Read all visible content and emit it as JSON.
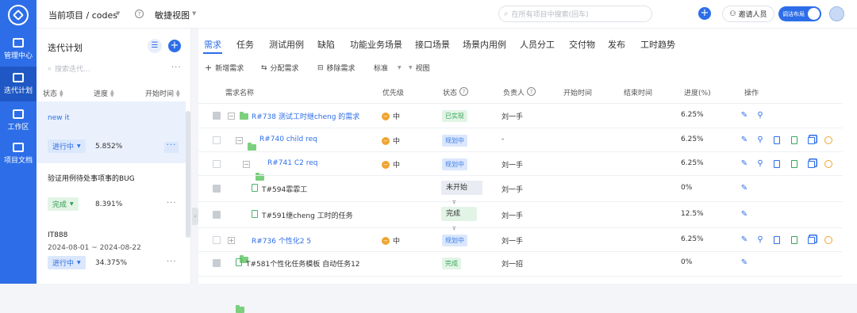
{
  "leftnav": {
    "items": [
      {
        "label": "管理中心",
        "icon": "monitor-icon"
      },
      {
        "label": "迭代计划",
        "icon": "clipboard-icon",
        "active": true
      },
      {
        "label": "工作区",
        "icon": "clipboard-check-icon"
      },
      {
        "label": "项目文档",
        "icon": "book-icon"
      }
    ]
  },
  "topbar": {
    "project_label": "当前项目 / codes",
    "view_label": "敏捷视图",
    "search_placeholder": "在所有项目中搜索(回车)",
    "invite_label": "邀请人员",
    "layout_toggle_label": "调洁布局"
  },
  "sprint_panel": {
    "title": "迭代计划",
    "search_placeholder": "搜索迭代...",
    "more": "···",
    "columns": [
      "状态",
      "进度",
      "开始时间"
    ],
    "sprints": [
      {
        "name": "new it",
        "status": "进行中",
        "progress": "5.852%",
        "dates": "",
        "selected": true
      },
      {
        "name": "验证用例待处事项事的BUG",
        "status": "完成",
        "progress": "8.391%",
        "dates": ""
      },
      {
        "name": "IT888",
        "status": "进行中",
        "progress": "34.375%",
        "dates": "2024-08-01 ~ 2024-08-22"
      }
    ]
  },
  "tabs": [
    "需求",
    "任务",
    "测试用例",
    "缺陷",
    "功能业务场景",
    "接口场景",
    "场景内用例",
    "人员分工",
    "交付物",
    "发布",
    "工时趋势"
  ],
  "toolbar": {
    "add": "新增需求",
    "assign": "分配需求",
    "remove": "移除需求",
    "mode": "标准",
    "view": "视图"
  },
  "table": {
    "headers": {
      "name": "需求名称",
      "priority": "优先级",
      "status": "状态",
      "owner": "负责人",
      "start": "开始时间",
      "end": "结束时间",
      "progress": "进度(%)",
      "ops": "操作"
    },
    "rows": [
      {
        "name": "R#738 测试工时继cheng 的需求",
        "priority": "中",
        "status": "已实现",
        "owner": "刘一手",
        "progress": "6.25%"
      },
      {
        "name": "R#740 child req",
        "priority": "中",
        "status": "规划中",
        "owner": "-",
        "progress": "6.25%"
      },
      {
        "name": "R#741 C2 req",
        "priority": "中",
        "status": "规划中",
        "owner": "刘一手",
        "progress": "6.25%"
      },
      {
        "name": "T#594霏霏工",
        "priority": "",
        "status": "未开始",
        "owner": "刘一手",
        "progress": "0%"
      },
      {
        "name": "T#591继cheng 工时的任务",
        "priority": "",
        "status": "完成",
        "owner": "刘一手",
        "progress": "12.5%"
      },
      {
        "name": "R#736 个性化2 5",
        "priority": "中",
        "status": "规划中",
        "owner": "刘一手",
        "progress": "6.25%"
      },
      {
        "name": "T#581个性化任务模板 自动任务12",
        "priority": "",
        "status": "完成",
        "owner": "刘一招",
        "progress": "0%"
      }
    ]
  },
  "colors": {
    "accent": "#2d6ee8",
    "green": "#3aa55a",
    "orange": "#f0a430"
  }
}
